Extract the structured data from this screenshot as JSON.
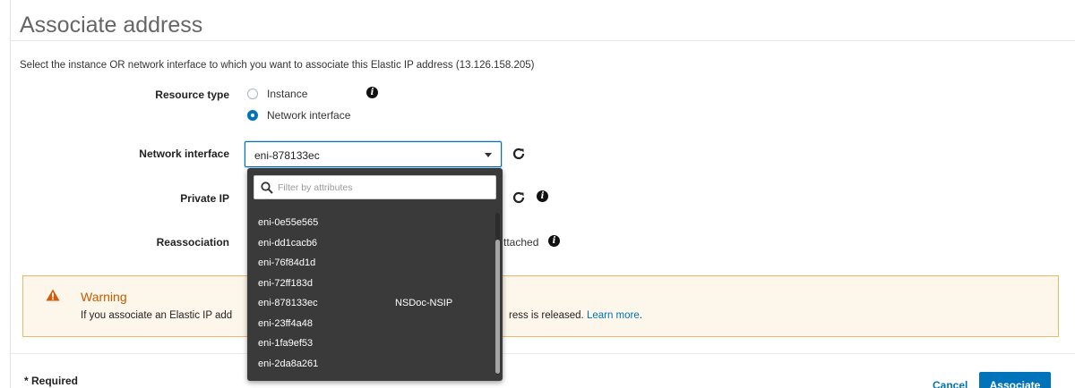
{
  "page": {
    "title": "Associate address",
    "intro": "Select the instance OR network interface to which you want to associate this Elastic IP address (13.126.158.205)"
  },
  "form": {
    "resource_type_label": "Resource type",
    "resource_options": [
      "Instance",
      "Network interface"
    ],
    "resource_selected": "Network interface",
    "network_interface_label": "Network interface",
    "network_interface_value": "eni-878133ec",
    "private_ip_label": "Private IP",
    "reassociation_label": "Reassociation",
    "reassociation_text_fragment": "ttached"
  },
  "dropdown": {
    "filter_placeholder": "Filter by attributes",
    "items": [
      {
        "id": "eni-0e55e565",
        "name": ""
      },
      {
        "id": "eni-dd1cacb6",
        "name": ""
      },
      {
        "id": "eni-76f84d1d",
        "name": ""
      },
      {
        "id": "eni-72ff183d",
        "name": ""
      },
      {
        "id": "eni-878133ec",
        "name": "NSDoc-NSIP"
      },
      {
        "id": "eni-23ff4a48",
        "name": ""
      },
      {
        "id": "eni-1fa9ef53",
        "name": ""
      },
      {
        "id": "eni-2da8a261",
        "name": ""
      }
    ]
  },
  "warning": {
    "title": "Warning",
    "text_left": "If you associate an Elastic IP add",
    "text_right": "ress is released.",
    "learn_more": "Learn more",
    "period": "."
  },
  "footer": {
    "required": "* Required",
    "cancel": "Cancel",
    "associate": "Associate"
  },
  "colors": {
    "accent": "#0073bb",
    "warning_border": "#f0b76b",
    "warning_bg": "#fdf6ea",
    "warning_title": "#c85a00",
    "dropdown_bg": "#3a3a3a"
  },
  "icons": {
    "info": "info-icon",
    "refresh": "refresh-icon",
    "warning": "warning-triangle-icon",
    "search": "search-icon",
    "caret": "chevron-down-icon"
  }
}
